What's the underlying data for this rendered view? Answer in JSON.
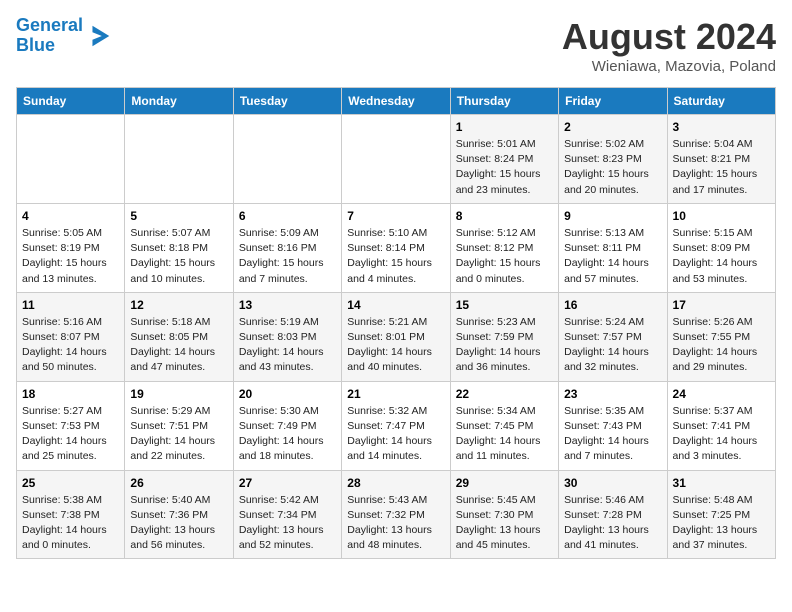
{
  "logo": {
    "line1": "General",
    "line2": "Blue"
  },
  "header": {
    "month": "August 2024",
    "location": "Wieniawa, Mazovia, Poland"
  },
  "weekdays": [
    "Sunday",
    "Monday",
    "Tuesday",
    "Wednesday",
    "Thursday",
    "Friday",
    "Saturday"
  ],
  "weeks": [
    [
      {
        "day": "",
        "info": ""
      },
      {
        "day": "",
        "info": ""
      },
      {
        "day": "",
        "info": ""
      },
      {
        "day": "",
        "info": ""
      },
      {
        "day": "1",
        "info": "Sunrise: 5:01 AM\nSunset: 8:24 PM\nDaylight: 15 hours\nand 23 minutes."
      },
      {
        "day": "2",
        "info": "Sunrise: 5:02 AM\nSunset: 8:23 PM\nDaylight: 15 hours\nand 20 minutes."
      },
      {
        "day": "3",
        "info": "Sunrise: 5:04 AM\nSunset: 8:21 PM\nDaylight: 15 hours\nand 17 minutes."
      }
    ],
    [
      {
        "day": "4",
        "info": "Sunrise: 5:05 AM\nSunset: 8:19 PM\nDaylight: 15 hours\nand 13 minutes."
      },
      {
        "day": "5",
        "info": "Sunrise: 5:07 AM\nSunset: 8:18 PM\nDaylight: 15 hours\nand 10 minutes."
      },
      {
        "day": "6",
        "info": "Sunrise: 5:09 AM\nSunset: 8:16 PM\nDaylight: 15 hours\nand 7 minutes."
      },
      {
        "day": "7",
        "info": "Sunrise: 5:10 AM\nSunset: 8:14 PM\nDaylight: 15 hours\nand 4 minutes."
      },
      {
        "day": "8",
        "info": "Sunrise: 5:12 AM\nSunset: 8:12 PM\nDaylight: 15 hours\nand 0 minutes."
      },
      {
        "day": "9",
        "info": "Sunrise: 5:13 AM\nSunset: 8:11 PM\nDaylight: 14 hours\nand 57 minutes."
      },
      {
        "day": "10",
        "info": "Sunrise: 5:15 AM\nSunset: 8:09 PM\nDaylight: 14 hours\nand 53 minutes."
      }
    ],
    [
      {
        "day": "11",
        "info": "Sunrise: 5:16 AM\nSunset: 8:07 PM\nDaylight: 14 hours\nand 50 minutes."
      },
      {
        "day": "12",
        "info": "Sunrise: 5:18 AM\nSunset: 8:05 PM\nDaylight: 14 hours\nand 47 minutes."
      },
      {
        "day": "13",
        "info": "Sunrise: 5:19 AM\nSunset: 8:03 PM\nDaylight: 14 hours\nand 43 minutes."
      },
      {
        "day": "14",
        "info": "Sunrise: 5:21 AM\nSunset: 8:01 PM\nDaylight: 14 hours\nand 40 minutes."
      },
      {
        "day": "15",
        "info": "Sunrise: 5:23 AM\nSunset: 7:59 PM\nDaylight: 14 hours\nand 36 minutes."
      },
      {
        "day": "16",
        "info": "Sunrise: 5:24 AM\nSunset: 7:57 PM\nDaylight: 14 hours\nand 32 minutes."
      },
      {
        "day": "17",
        "info": "Sunrise: 5:26 AM\nSunset: 7:55 PM\nDaylight: 14 hours\nand 29 minutes."
      }
    ],
    [
      {
        "day": "18",
        "info": "Sunrise: 5:27 AM\nSunset: 7:53 PM\nDaylight: 14 hours\nand 25 minutes."
      },
      {
        "day": "19",
        "info": "Sunrise: 5:29 AM\nSunset: 7:51 PM\nDaylight: 14 hours\nand 22 minutes."
      },
      {
        "day": "20",
        "info": "Sunrise: 5:30 AM\nSunset: 7:49 PM\nDaylight: 14 hours\nand 18 minutes."
      },
      {
        "day": "21",
        "info": "Sunrise: 5:32 AM\nSunset: 7:47 PM\nDaylight: 14 hours\nand 14 minutes."
      },
      {
        "day": "22",
        "info": "Sunrise: 5:34 AM\nSunset: 7:45 PM\nDaylight: 14 hours\nand 11 minutes."
      },
      {
        "day": "23",
        "info": "Sunrise: 5:35 AM\nSunset: 7:43 PM\nDaylight: 14 hours\nand 7 minutes."
      },
      {
        "day": "24",
        "info": "Sunrise: 5:37 AM\nSunset: 7:41 PM\nDaylight: 14 hours\nand 3 minutes."
      }
    ],
    [
      {
        "day": "25",
        "info": "Sunrise: 5:38 AM\nSunset: 7:38 PM\nDaylight: 14 hours\nand 0 minutes."
      },
      {
        "day": "26",
        "info": "Sunrise: 5:40 AM\nSunset: 7:36 PM\nDaylight: 13 hours\nand 56 minutes."
      },
      {
        "day": "27",
        "info": "Sunrise: 5:42 AM\nSunset: 7:34 PM\nDaylight: 13 hours\nand 52 minutes."
      },
      {
        "day": "28",
        "info": "Sunrise: 5:43 AM\nSunset: 7:32 PM\nDaylight: 13 hours\nand 48 minutes."
      },
      {
        "day": "29",
        "info": "Sunrise: 5:45 AM\nSunset: 7:30 PM\nDaylight: 13 hours\nand 45 minutes."
      },
      {
        "day": "30",
        "info": "Sunrise: 5:46 AM\nSunset: 7:28 PM\nDaylight: 13 hours\nand 41 minutes."
      },
      {
        "day": "31",
        "info": "Sunrise: 5:48 AM\nSunset: 7:25 PM\nDaylight: 13 hours\nand 37 minutes."
      }
    ]
  ]
}
